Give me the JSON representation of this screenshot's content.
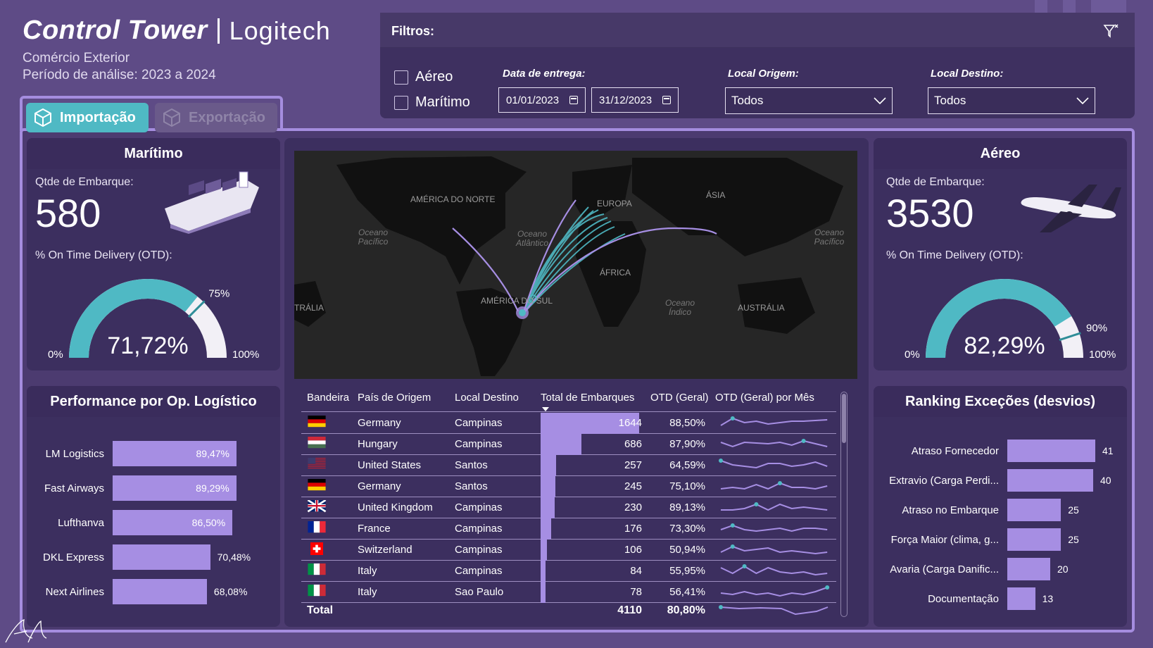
{
  "header": {
    "title": "Control Tower",
    "brand": "Logitech",
    "subtitle1": "Comércio Exterior",
    "subtitle2": "Período de análise: 2023 a 2024"
  },
  "filters": {
    "title": "Filtros:",
    "checkbox_air": "Aéreo",
    "checkbox_sea": "Marítimo",
    "date_label": "Data de entrega:",
    "date_start": "01/01/2023",
    "date_end": "31/12/2023",
    "origin_label": "Local Origem:",
    "origin_value": "Todos",
    "dest_label": "Local Destino:",
    "dest_value": "Todos"
  },
  "tabs": {
    "import": "Importação",
    "export": "Exportação"
  },
  "maritimo": {
    "title": "Marítimo",
    "qty_label": "Qtde de Embarque:",
    "qty_value": "580",
    "otd_label": "% On Time Delivery (OTD):",
    "otd_value": "71,72%",
    "otd_fraction": 0.7172,
    "target_label": "75%",
    "target_fraction": 0.75,
    "min_label": "0%",
    "max_label": "100%"
  },
  "aereo": {
    "title": "Aéreo",
    "qty_label": "Qtde de Embarque:",
    "qty_value": "3530",
    "otd_label": "% On Time Delivery (OTD):",
    "otd_value": "82,29%",
    "otd_fraction": 0.8229,
    "target_label": "90%",
    "target_fraction": 0.9,
    "min_label": "0%",
    "max_label": "100%"
  },
  "performance": {
    "title": "Performance por Op. Logístico",
    "rows": [
      {
        "name": "LM Logistics",
        "value": "89,47%",
        "num": 89.47
      },
      {
        "name": "Fast Airways",
        "value": "89,29%",
        "num": 89.29
      },
      {
        "name": "Lufthanva",
        "value": "86,50%",
        "num": 86.5
      },
      {
        "name": "DKL Express",
        "value": "70,48%",
        "num": 70.48
      },
      {
        "name": "Next Airlines",
        "value": "68,08%",
        "num": 68.08
      }
    ]
  },
  "ranking": {
    "title": "Ranking Exceções (desvios)",
    "rows": [
      {
        "name": "Atraso Fornecedor",
        "value": "41",
        "num": 41
      },
      {
        "name": "Extravio (Carga Perdi...",
        "value": "40",
        "num": 40
      },
      {
        "name": "Atraso no Embarque",
        "value": "25",
        "num": 25
      },
      {
        "name": "Força Maior (clima, g...",
        "value": "25",
        "num": 25
      },
      {
        "name": "Avaria (Carga Danific...",
        "value": "20",
        "num": 20
      },
      {
        "name": "Documentação",
        "value": "13",
        "num": 13
      }
    ]
  },
  "map": {
    "labels": [
      "AMÉRICA DO NORTE",
      "EUROPA",
      "ÁSIA",
      "ÁFRICA",
      "AMÉRICA DO SUL",
      "AUSTRÁLIA",
      "TRÁLIA"
    ],
    "oceans": [
      "Oceano Pacífico",
      "Oceano Atlântico",
      "Oceano Pacífico",
      "Oceano Índico"
    ]
  },
  "table": {
    "headers": [
      "Bandeira",
      "País de Origem",
      "Local Destino",
      "Total de Embarques",
      "OTD (Geral)",
      "OTD (Geral) por Mês"
    ],
    "rows": [
      {
        "flag": "de",
        "country": "Germany",
        "dest": "Campinas",
        "total": "1644",
        "total_num": 1644,
        "otd": "88,50%"
      },
      {
        "flag": "hu",
        "country": "Hungary",
        "dest": "Campinas",
        "total": "686",
        "total_num": 686,
        "otd": "87,90%"
      },
      {
        "flag": "us",
        "country": "United States",
        "dest": "Santos",
        "total": "257",
        "total_num": 257,
        "otd": "64,59%"
      },
      {
        "flag": "de",
        "country": "Germany",
        "dest": "Santos",
        "total": "245",
        "total_num": 245,
        "otd": "75,10%"
      },
      {
        "flag": "gb",
        "country": "United Kingdom",
        "dest": "Campinas",
        "total": "230",
        "total_num": 230,
        "otd": "89,13%"
      },
      {
        "flag": "fr",
        "country": "France",
        "dest": "Campinas",
        "total": "176",
        "total_num": 176,
        "otd": "73,30%"
      },
      {
        "flag": "ch",
        "country": "Switzerland",
        "dest": "Campinas",
        "total": "106",
        "total_num": 106,
        "otd": "50,94%"
      },
      {
        "flag": "it",
        "country": "Italy",
        "dest": "Campinas",
        "total": "84",
        "total_num": 84,
        "otd": "55,95%"
      },
      {
        "flag": "it",
        "country": "Italy",
        "dest": "Sao Paulo",
        "total": "78",
        "total_num": 78,
        "otd": "56,41%"
      }
    ],
    "total_label": "Total",
    "total_value": "4110",
    "total_otd": "80,80%"
  },
  "colors": {
    "accent": "#4fb9c4",
    "bar": "#a68ee3",
    "frame": "#a58ddf",
    "panel": "#3c2f5f"
  }
}
